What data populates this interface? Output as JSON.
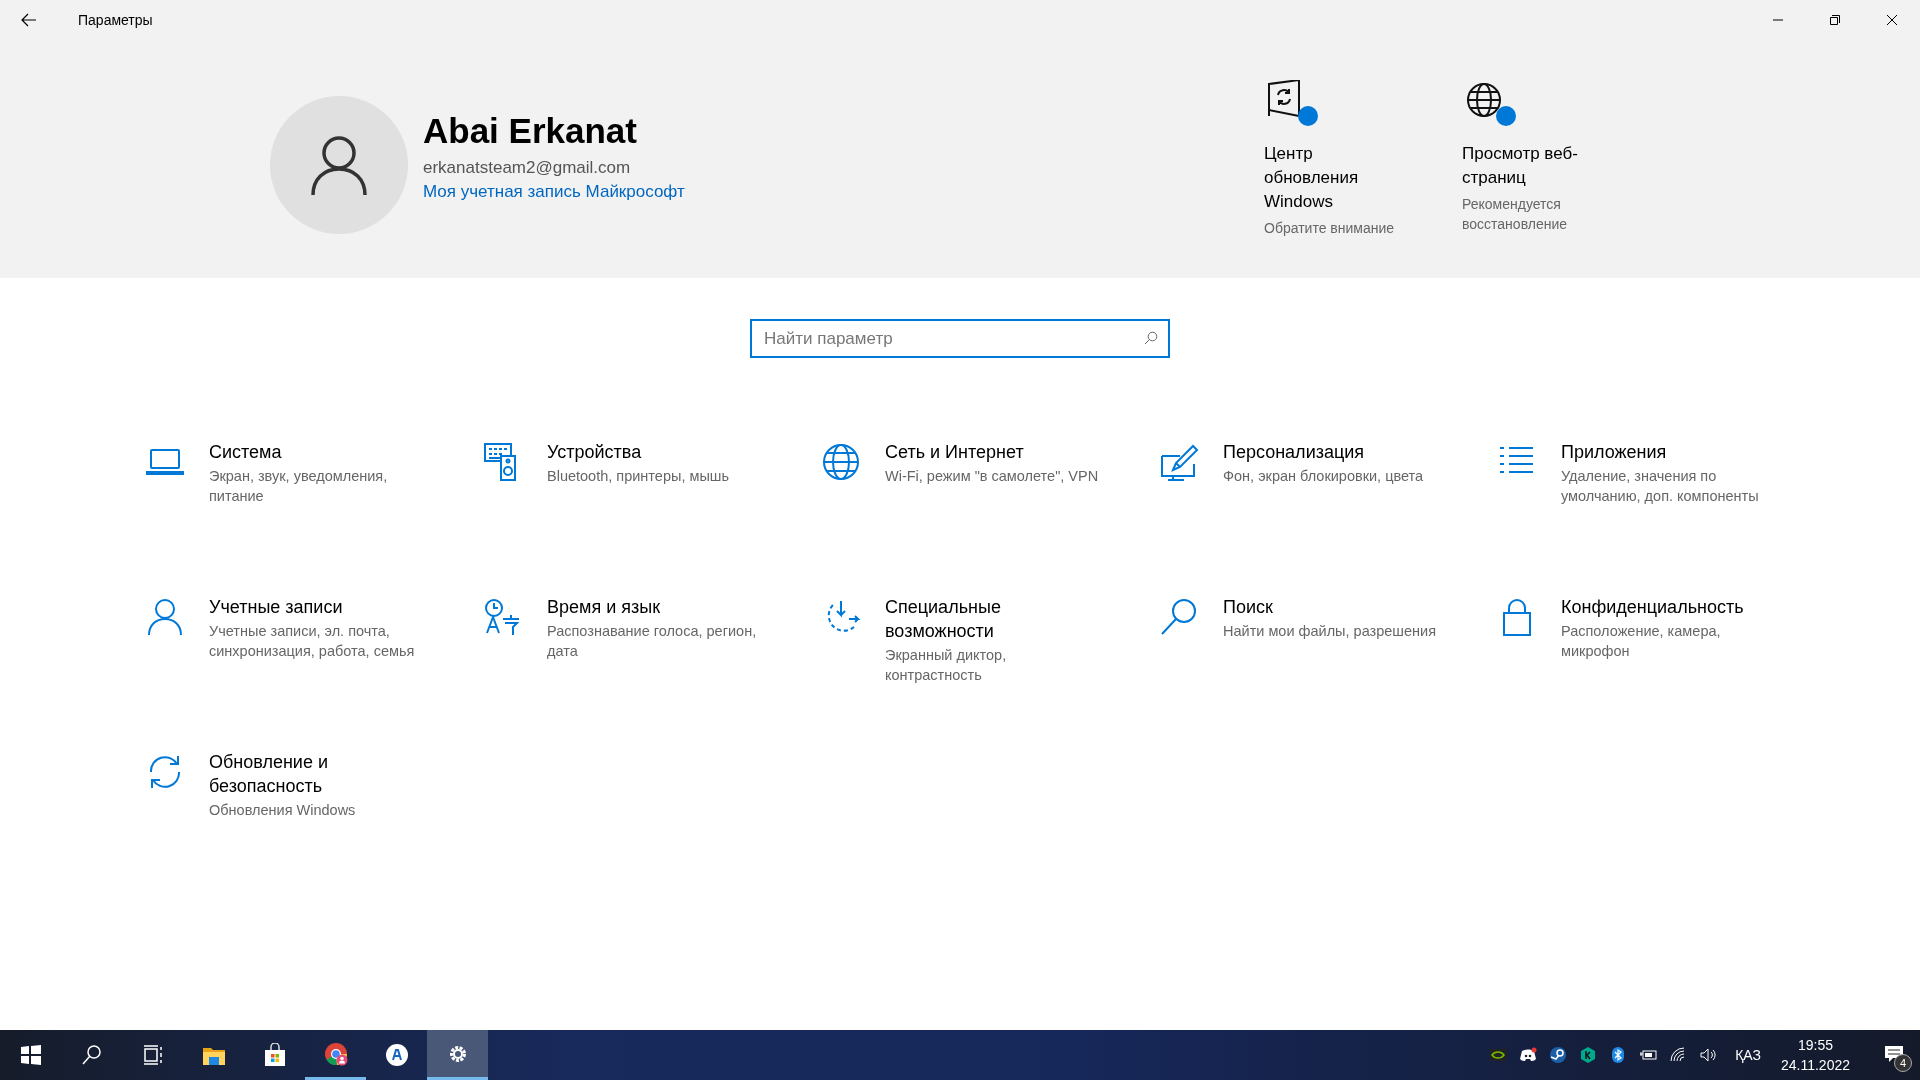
{
  "window": {
    "title": "Параметры"
  },
  "account": {
    "name": "Abai Erkanat",
    "email": "erkanatsteam2@gmail.com",
    "link": "Моя учетная запись Майкрософт"
  },
  "alerts": [
    {
      "kind": "update",
      "title": "Центр обновления Windows",
      "note": "Обратите внимание",
      "color": "#0078d7"
    },
    {
      "kind": "browser",
      "title": "Просмотр веб-страниц",
      "note": "Рекомендуется восстановление",
      "color": "#0078d7"
    }
  ],
  "search": {
    "placeholder": "Найти параметр"
  },
  "categories": [
    {
      "kind": "laptop",
      "title": "Система",
      "description": "Экран, звук, уведомления, питание"
    },
    {
      "kind": "devices",
      "title": "Устройства",
      "description": "Bluetooth, принтеры, мышь"
    },
    {
      "kind": "globe",
      "title": "Сеть и Интернет",
      "description": "Wi-Fi, режим \"в самолете\", VPN"
    },
    {
      "kind": "pen",
      "title": "Персонализация",
      "description": "Фон, экран блокировки, цвета"
    },
    {
      "kind": "list",
      "title": "Приложения",
      "description": "Удаление, значения по умолчанию, доп. компоненты"
    },
    {
      "kind": "person",
      "title": "Учетные записи",
      "description": "Учетные записи, эл. почта, синхронизация, работа, семья"
    },
    {
      "kind": "time",
      "title": "Время и язык",
      "description": "Распознавание голоса, регион, дата"
    },
    {
      "kind": "access",
      "title": "Специальные возможности",
      "description": "Экранный диктор, контрастность"
    },
    {
      "kind": "search",
      "title": "Поиск",
      "description": "Найти мои файлы, разрешения"
    },
    {
      "kind": "lock",
      "title": "Конфиденциальность",
      "description": "Расположение, камера, микрофон"
    },
    {
      "kind": "sync",
      "title": "Обновление и безопасность",
      "description": "Обновления Windows"
    }
  ],
  "taskbar": {
    "apps": [
      {
        "kind": "start",
        "open": false,
        "selected": false
      },
      {
        "kind": "search",
        "open": false,
        "selected": false
      },
      {
        "kind": "taskview",
        "open": false,
        "selected": false
      },
      {
        "kind": "folder",
        "open": false,
        "selected": false
      },
      {
        "kind": "store",
        "open": false,
        "selected": false
      },
      {
        "kind": "chrome",
        "open": true,
        "selected": false
      },
      {
        "kind": "circle",
        "open": false,
        "selected": false
      },
      {
        "kind": "gear",
        "open": true,
        "selected": true
      }
    ],
    "tray": [
      {
        "kind": "nvidia"
      },
      {
        "kind": "discord"
      },
      {
        "kind": "steam"
      },
      {
        "kind": "k"
      },
      {
        "kind": "bluetooth"
      },
      {
        "kind": "battery"
      },
      {
        "kind": "wifi"
      },
      {
        "kind": "volume"
      }
    ],
    "language": "ҚАЗ",
    "time": "19:55",
    "date": "24.11.2022",
    "notifications": "4"
  }
}
